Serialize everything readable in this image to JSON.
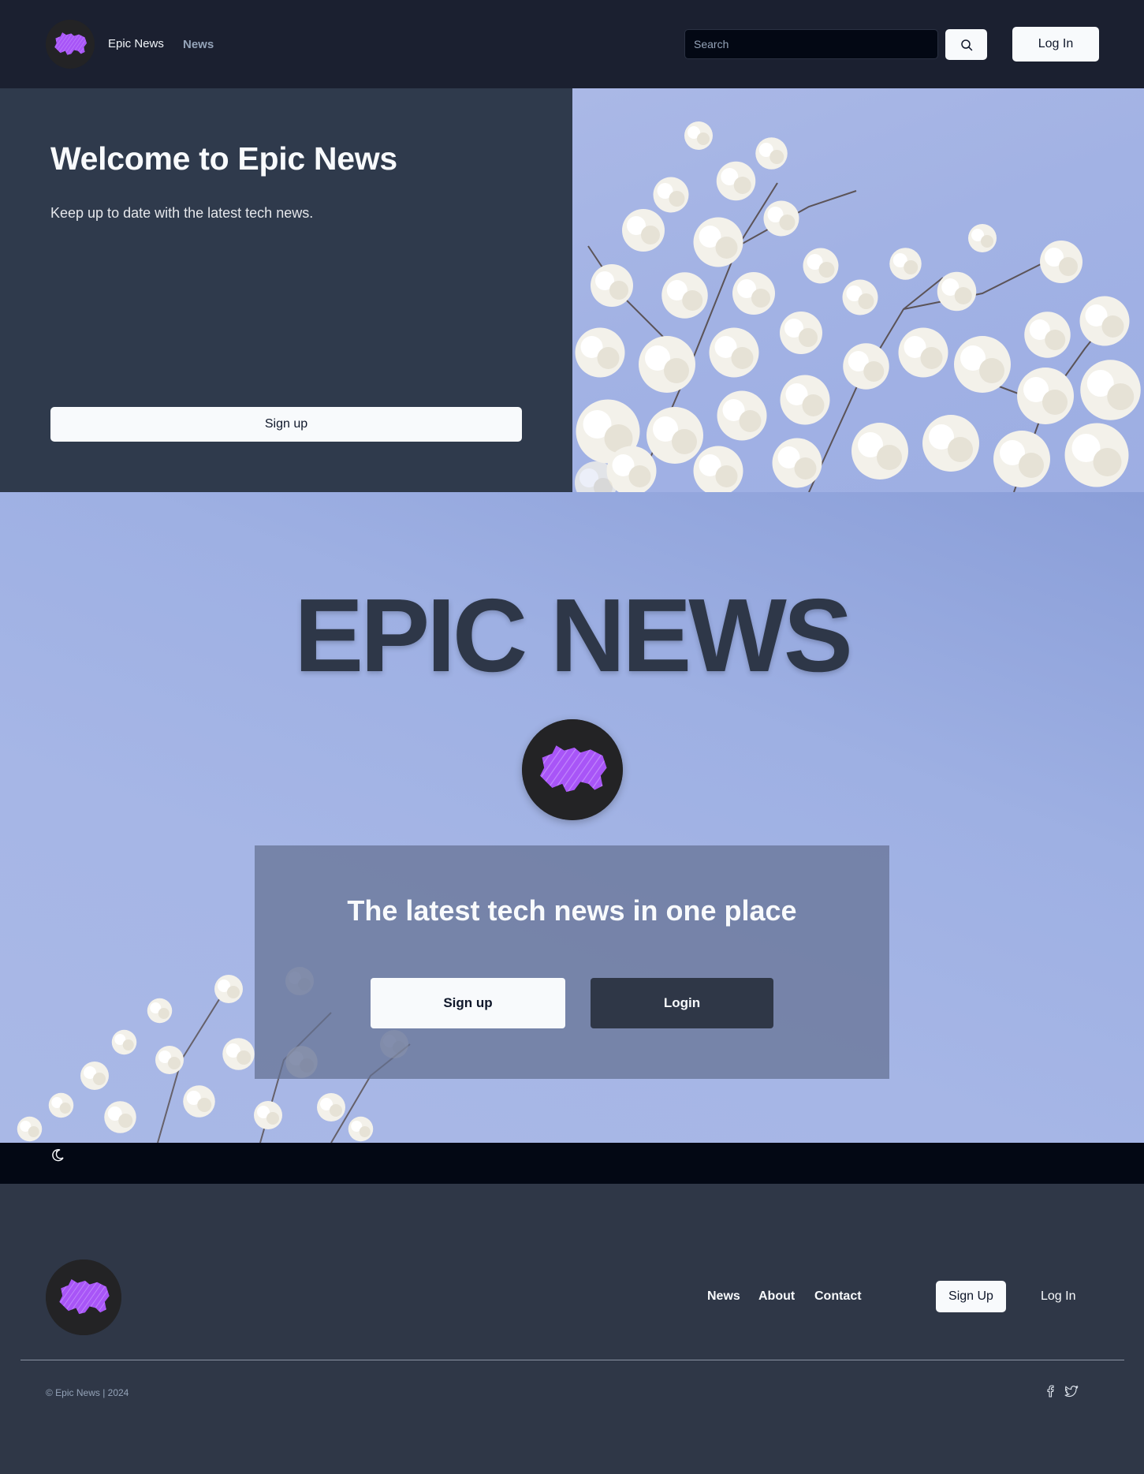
{
  "header": {
    "brand": "Epic News",
    "nav": [
      {
        "label": "News"
      }
    ],
    "search": {
      "placeholder": "Search",
      "value": ""
    },
    "login_label": "Log In"
  },
  "hero": {
    "title": "Welcome to Epic News",
    "subtitle": "Keep up to date with the latest tech news.",
    "signup_label": "Sign up"
  },
  "banner": {
    "title": "EPIC NEWS",
    "cta_heading": "The latest tech news in one place",
    "signup_label": "Sign up",
    "login_label": "Login"
  },
  "footer": {
    "links": [
      {
        "label": "News"
      },
      {
        "label": "About"
      },
      {
        "label": "Contact"
      }
    ],
    "signup_label": "Sign Up",
    "login_label": "Log In",
    "copyright": "© Epic News | 2024"
  },
  "icons": {
    "logo": "purple-elephant-logo",
    "search": "search-icon",
    "theme": "moon-icon",
    "social": [
      "facebook-icon",
      "twitter-icon"
    ]
  },
  "colors": {
    "header_bg": "#1b2030",
    "hero_bg": "#2f3a4c",
    "accent_purple": "#a855f7",
    "sky_blue": "#a2b2e4",
    "footer_bg": "#2f3747",
    "theme_bar_bg": "#030814"
  }
}
